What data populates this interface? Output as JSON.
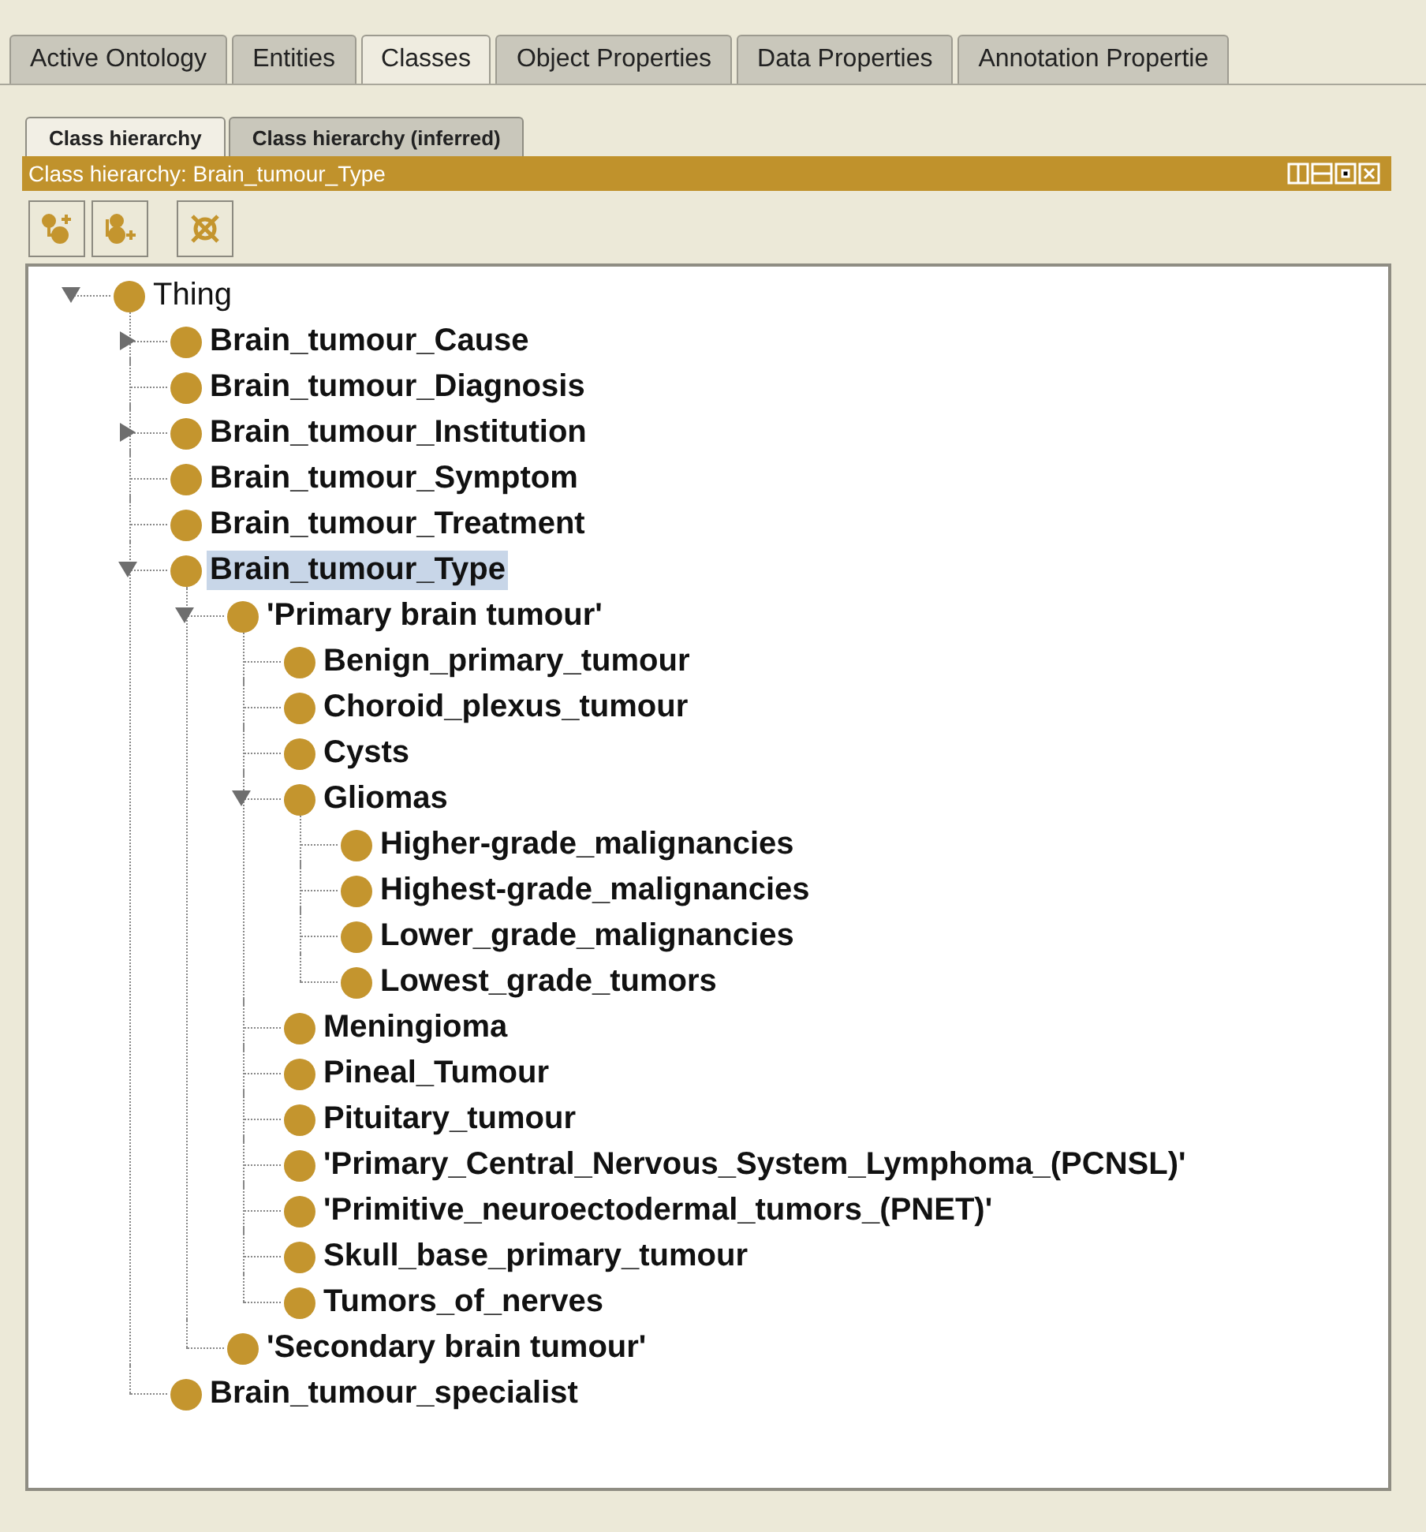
{
  "tabs": [
    {
      "label": "Active Ontology",
      "selected": false
    },
    {
      "label": "Entities",
      "selected": false
    },
    {
      "label": "Classes",
      "selected": true
    },
    {
      "label": "Object Properties",
      "selected": false
    },
    {
      "label": "Data Properties",
      "selected": false
    },
    {
      "label": "Annotation Propertie",
      "selected": false
    }
  ],
  "view_tabs": [
    {
      "label": "Class hierarchy",
      "selected": true
    },
    {
      "label": "Class hierarchy (inferred)",
      "selected": false
    }
  ],
  "view_title": "Class hierarchy: Brain_tumour_Type",
  "tree": {
    "root": {
      "label": "Thing",
      "expanded": true,
      "selected": false,
      "children": [
        {
          "label": "Brain_tumour_Cause",
          "expanded": false,
          "selected": false
        },
        {
          "label": "Brain_tumour_Diagnosis",
          "selected": false
        },
        {
          "label": "Brain_tumour_Institution",
          "expanded": false,
          "selected": false
        },
        {
          "label": "Brain_tumour_Symptom",
          "selected": false
        },
        {
          "label": "Brain_tumour_Treatment",
          "selected": false
        },
        {
          "label": "Brain_tumour_Type",
          "expanded": true,
          "selected": true,
          "children": [
            {
              "label": "'Primary brain tumour'",
              "expanded": true,
              "selected": false,
              "children": [
                {
                  "label": "Benign_primary_tumour",
                  "selected": false
                },
                {
                  "label": "Choroid_plexus_tumour",
                  "selected": false
                },
                {
                  "label": "Cysts",
                  "selected": false
                },
                {
                  "label": "Gliomas",
                  "expanded": true,
                  "selected": false,
                  "children": [
                    {
                      "label": "Higher-grade_malignancies",
                      "selected": false
                    },
                    {
                      "label": "Highest-grade_malignancies",
                      "selected": false
                    },
                    {
                      "label": "Lower_grade_malignancies",
                      "selected": false
                    },
                    {
                      "label": "Lowest_grade_tumors",
                      "selected": false
                    }
                  ]
                },
                {
                  "label": "Meningioma",
                  "selected": false
                },
                {
                  "label": "Pineal_Tumour",
                  "selected": false
                },
                {
                  "label": "Pituitary_tumour",
                  "selected": false
                },
                {
                  "label": "'Primary_Central_Nervous_System_Lymphoma_(PCNSL)'",
                  "selected": false
                },
                {
                  "label": "'Primitive_neuroectodermal_tumors_(PNET)'",
                  "selected": false
                },
                {
                  "label": "Skull_base_primary_tumour",
                  "selected": false
                },
                {
                  "label": "Tumors_of_nerves",
                  "selected": false
                }
              ]
            },
            {
              "label": "'Secondary brain tumour'",
              "selected": false
            }
          ]
        },
        {
          "label": "Brain_tumour_specialist",
          "selected": false
        }
      ]
    }
  }
}
